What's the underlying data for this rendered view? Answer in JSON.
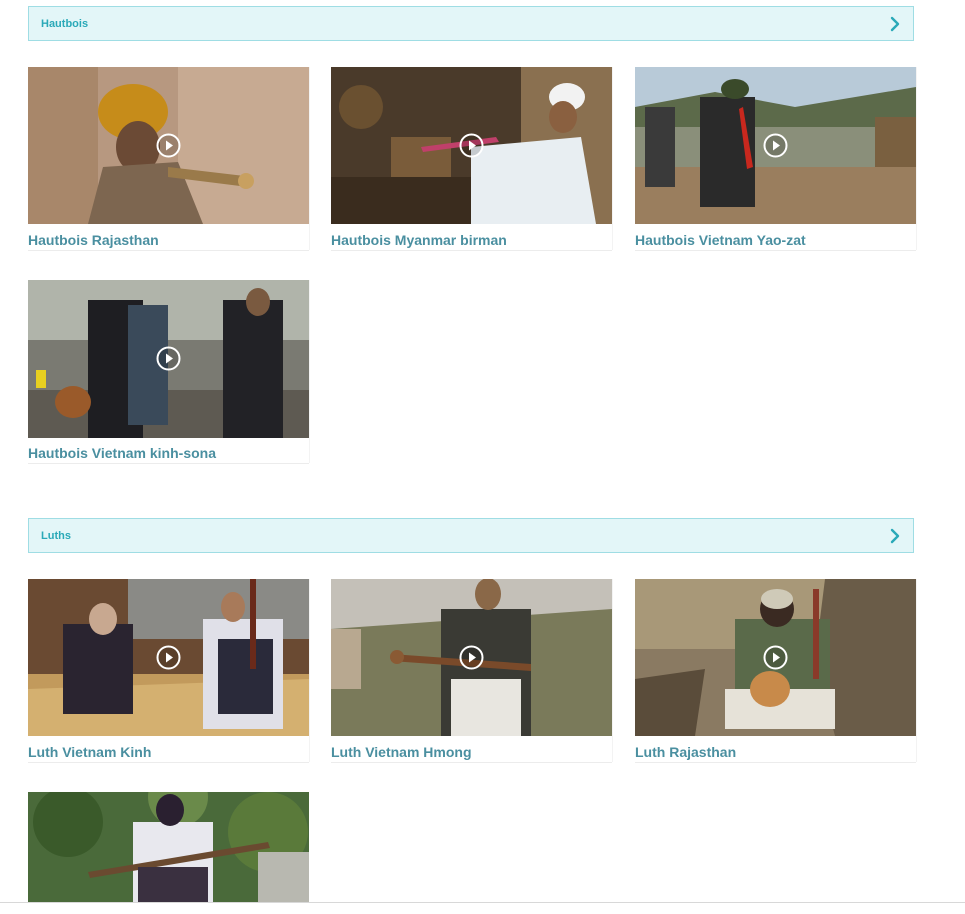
{
  "sections": [
    {
      "title": "Hautbois",
      "videos": [
        {
          "caption": "Hautbois Rajasthan"
        },
        {
          "caption": "Hautbois Myanmar birman"
        },
        {
          "caption": "Hautbois Vietnam Yao-zat"
        },
        {
          "caption": "Hautbois Vietnam kinh-sona"
        }
      ]
    },
    {
      "title": "Luths",
      "videos": [
        {
          "caption": "Luth Vietnam Kinh"
        },
        {
          "caption": "Luth Vietnam Hmong"
        },
        {
          "caption": "Luth Rajasthan"
        },
        {
          "caption": ""
        }
      ]
    }
  ],
  "icons": {
    "expand": "chevron-right-icon",
    "play": "play-circle-icon"
  },
  "colors": {
    "header_bg": "#e3f6f8",
    "header_border": "#9fdde4",
    "header_text": "#2aa9b8",
    "caption_text": "#4a8fa0"
  }
}
